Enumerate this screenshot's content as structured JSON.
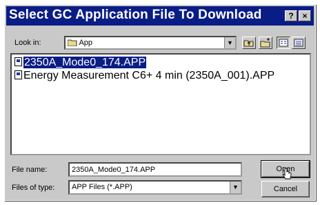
{
  "dialog": {
    "title": "Select GC Application File To Download",
    "help_label": "?",
    "close_label": "×"
  },
  "look_in": {
    "label": "Look in:",
    "value": "App"
  },
  "files": [
    "2350A_Mode0_174.APP",
    "Energy Measurement C6+ 4 min (2350A_001).APP"
  ],
  "filename": {
    "label": "File name:",
    "value": "2350A_Mode0_174.APP"
  },
  "filetype": {
    "label": "Files of type:",
    "value": "APP Files (*.APP)"
  },
  "buttons": {
    "open": "Open",
    "cancel": "Cancel"
  }
}
